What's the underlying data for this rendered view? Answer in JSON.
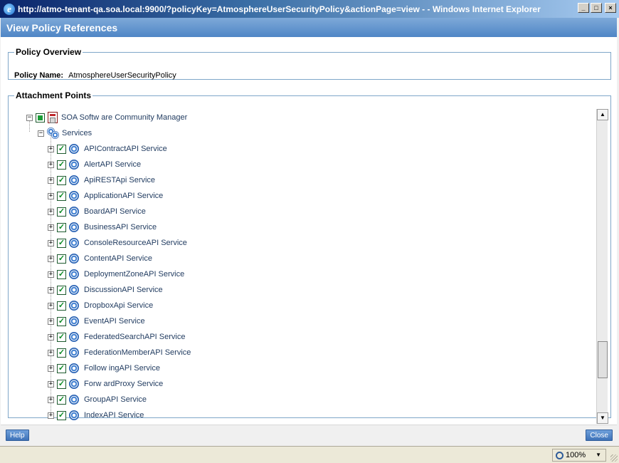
{
  "window": {
    "title": "http://atmo-tenant-qa.soa.local:9900/?policyKey=AtmosphereUserSecurityPolicy&actionPage=view - - Windows Internet Explorer",
    "minimize": "_",
    "maximize": "□",
    "close": "×"
  },
  "dialog": {
    "title": "View Policy References"
  },
  "overview": {
    "legend": "Policy Overview",
    "name_label": "Policy Name:",
    "name_value": "AtmosphereUserSecurityPolicy"
  },
  "attachments": {
    "legend": "Attachment Points",
    "root": {
      "label": "SOA Softw are Community Manager",
      "expander": "−"
    },
    "services": {
      "label": "Services",
      "expander": "−"
    },
    "items": [
      "APIContractAPI Service",
      "AlertAPI Service",
      "ApiRESTApi Service",
      "ApplicationAPI Service",
      "BoardAPI Service",
      "BusinessAPI Service",
      "ConsoleResourceAPI Service",
      "ContentAPI Service",
      "DeploymentZoneAPI Service",
      "DiscussionAPI Service",
      "DropboxApi Service",
      "EventAPI Service",
      "FederatedSearchAPI Service",
      "FederationMemberAPI Service",
      "Follow ingAPI Service",
      "Forw ardProxy Service",
      "GroupAPI Service",
      "IndexAPI Service"
    ],
    "item_expander": "+",
    "item_check": "✓"
  },
  "footer": {
    "help": "Help",
    "close": "Close"
  },
  "statusbar": {
    "zoom": "100%"
  }
}
